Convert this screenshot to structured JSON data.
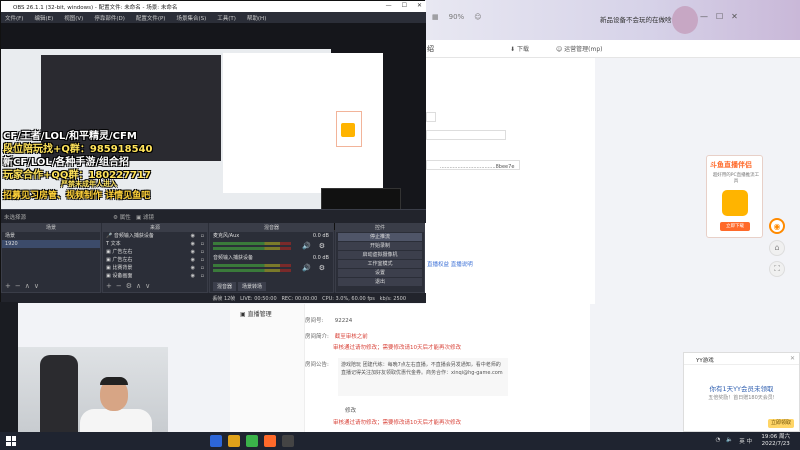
{
  "obs": {
    "title": "OBS 26.1.1 (32-bit, windows) - 配置文件: 未命名 - 场景: 未命名",
    "menu": [
      "文件(F)",
      "编辑(E)",
      "视图(V)",
      "停靠部件(D)",
      "配置文件(P)",
      "场景集合(S)",
      "工具(T)",
      "帮助(H)"
    ],
    "stream_lines": [
      "CF/王者/LOL/和平精灵/CFM",
      "段位陪玩找+Q群：985918540",
      "新CF/LOL/各种手游/组合招",
      "玩家合作+QQ群：180227717",
      "严禁未成年人进入",
      "招募见习房管、视频制作 详情见鱼吧"
    ],
    "section_label": "未选择源",
    "section_props": "属性",
    "section_filter": "滤镜",
    "scenes": {
      "header": "场景",
      "items": [
        "场景",
        "1920"
      ]
    },
    "sources": {
      "header": "来源",
      "items": [
        "音频输入捕获设备",
        "文本",
        "广告左右",
        "广告左右",
        "比赛背景",
        "设备画面"
      ]
    },
    "mixer": {
      "header": "混音器",
      "channels": [
        {
          "name": "麦克风/Aux",
          "db": "0.0 dB"
        },
        {
          "name": "音频输入捕获设备",
          "db": "0.0 dB"
        }
      ],
      "tabs": [
        "混音器",
        "场景转场"
      ]
    },
    "controls": {
      "header": "控件",
      "buttons": [
        "停止推流",
        "开始录制",
        "启动虚拟摄像机",
        "工作室模式",
        "设置",
        "退出"
      ]
    },
    "status": {
      "drop": "丢帧 12帧",
      "live": "LIVE: 00:50:00",
      "rec": "REC: 00:00:00",
      "cpu": "CPU: 3.0%, 60.00 fps",
      "kbps": "kb/s: 2500"
    }
  },
  "web": {
    "title_tail": "绍",
    "download": "下载",
    "user_mgr": "运营管理(mp)",
    "zoom": "90%",
    "promo": "新品设备不会玩的在做啥",
    "menu_item": "直播管理",
    "hash": "...................................8bee7e",
    "links": "直播权益    直播说明",
    "rows": [
      {
        "label": "房间号:",
        "value": "92224",
        "red": false
      },
      {
        "label": "房间简介:",
        "value": "截至审核之前",
        "red": true
      },
      {
        "label": "",
        "value": "审核通过请勿修改；需要修改请10天后才能再次修改",
        "red": true
      },
      {
        "label": "房间公告:",
        "value": "",
        "red": false
      }
    ],
    "desc": "游戏陪玩 团建代练：每晚7点左右直播，不直播会另发通知，看中老师的直播记得关注加好友领取优惠代金券。商务合作：xinqi@hg-game.com",
    "footer_label": "修改",
    "footer_red": "审核通过请勿修改；需要修改请10天后才能再次修改",
    "ad": {
      "title": "斗鱼直播伴侣",
      "sub": "超好用的PC直播推流工具",
      "button": "立即下载"
    }
  },
  "yy": {
    "head": "YY游戏",
    "title": "你有1天YY会员未领取",
    "sub": "五倍奖励！首日赠180天会员!",
    "button": "立即领取"
  },
  "taskbar": {
    "tray": "英 中",
    "time": "19:06 周六",
    "date": "2022/7/23"
  }
}
